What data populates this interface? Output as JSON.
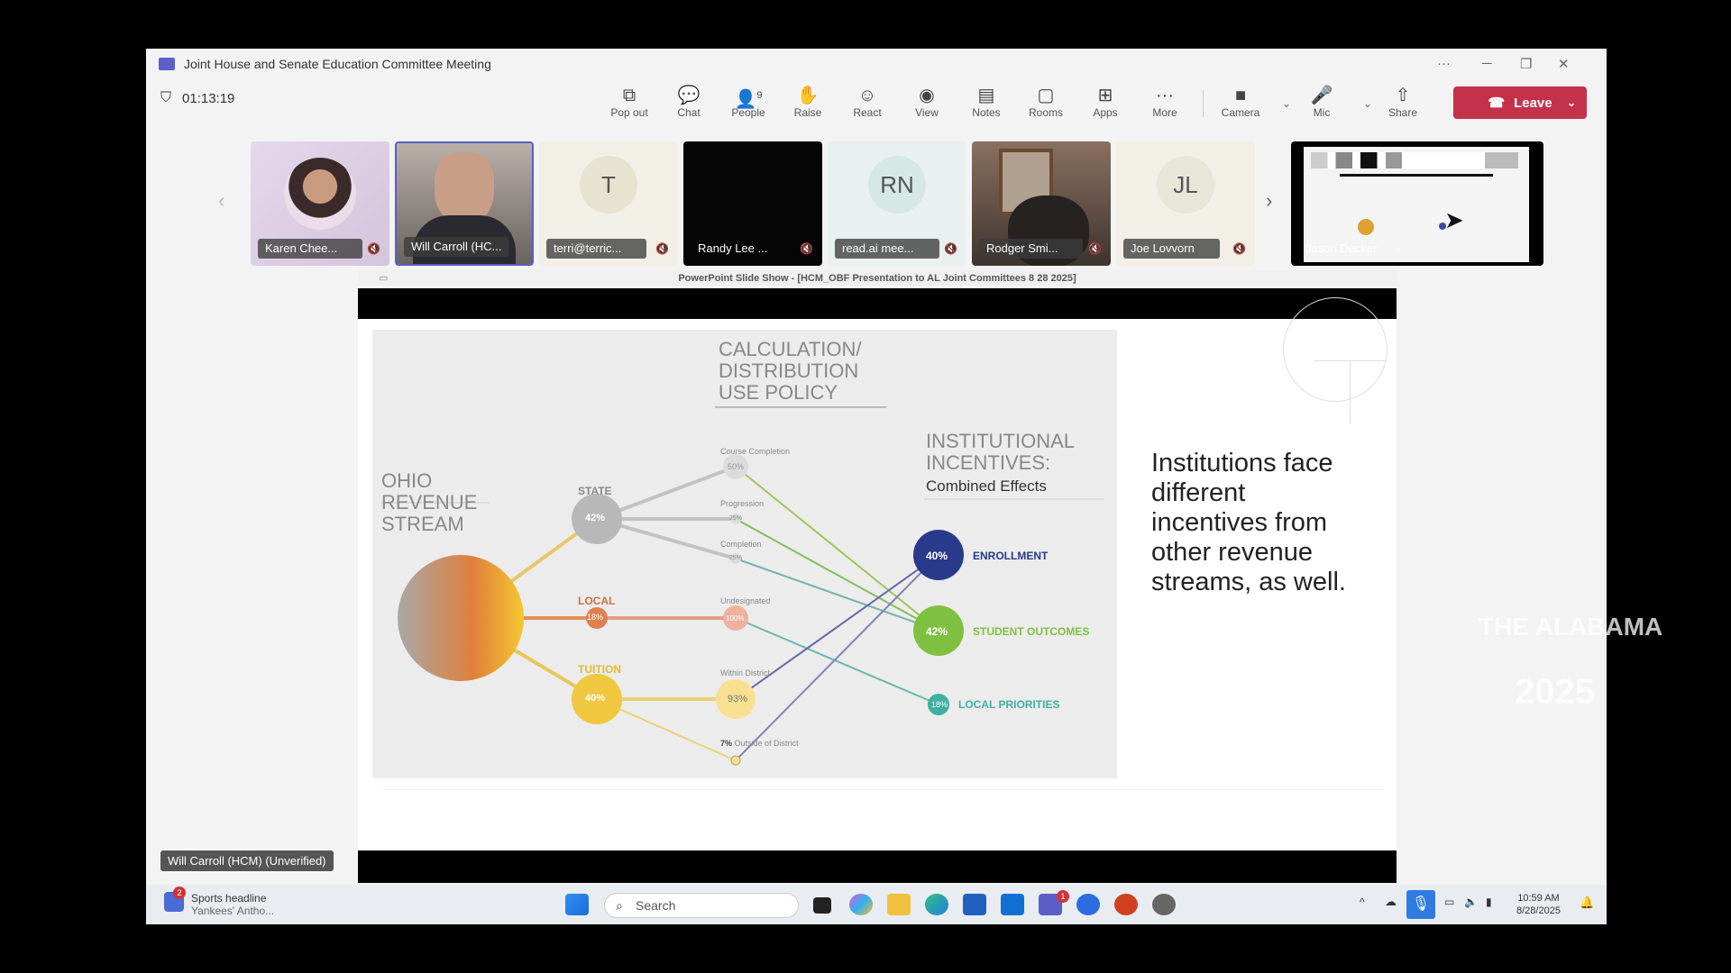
{
  "window": {
    "title": "Joint House and Senate Education Committee Meeting",
    "more": "···",
    "minimize": "─",
    "restore": "❐",
    "close": "✕"
  },
  "toolbar": {
    "timer": "01:13:19",
    "people_count": "9",
    "buttons": [
      {
        "label": "Pop out",
        "icon": "⧉"
      },
      {
        "label": "Chat",
        "icon": "💬"
      },
      {
        "label": "People",
        "icon": "👤"
      },
      {
        "label": "Raise",
        "icon": "✋"
      },
      {
        "label": "React",
        "icon": "☺"
      },
      {
        "label": "View",
        "icon": "◉"
      },
      {
        "label": "Notes",
        "icon": "▤"
      },
      {
        "label": "Rooms",
        "icon": "▢"
      },
      {
        "label": "Apps",
        "icon": "⊞"
      },
      {
        "label": "More",
        "icon": "···"
      },
      {
        "label": "Camera",
        "icon": "■"
      },
      {
        "label": "Mic",
        "icon": "🎤"
      },
      {
        "label": "Share",
        "icon": "⇧"
      }
    ],
    "leave_label": "Leave"
  },
  "participants": [
    {
      "name": "Karen Chee..."
    },
    {
      "name": "Will Carroll (HC..."
    },
    {
      "name": "terri@terric...",
      "initials": "T"
    },
    {
      "name": "Randy Lee ..."
    },
    {
      "name": "read.ai mee...",
      "initials": "RN"
    },
    {
      "name": "Rodger Smi..."
    },
    {
      "name": "Joe Lovvorn",
      "initials": "JL"
    },
    {
      "name": "Jason Decker"
    }
  ],
  "strip": {
    "prev": "‹",
    "next": "›",
    "more": "···"
  },
  "ppt_bar": "PowerPoint Slide Show - [HCM_OBF Presentation to AL Joint Committees 8 28 2025]",
  "slide": {
    "heading": [
      "CALCULATION/",
      "DISTRIBUTION",
      "USE POLICY"
    ],
    "source": [
      "OHIO",
      "REVENUE",
      "STREAM"
    ],
    "incentives": [
      "INSTITUTIONAL",
      "INCENTIVES:"
    ],
    "combined": "Combined Effects",
    "streams": [
      {
        "label": "STATE",
        "value": "42%"
      },
      {
        "label": "LOCAL",
        "value": "18%"
      },
      {
        "label": "TUITION",
        "value": "40%"
      }
    ],
    "policies": [
      {
        "label": "Course Completion",
        "value": "50%"
      },
      {
        "label": "Progression",
        "value": "25%"
      },
      {
        "label": "Completion",
        "value": "25%"
      },
      {
        "label": "Undesignated",
        "value": "100%"
      },
      {
        "label": "Within District",
        "value": "93%"
      },
      {
        "pct": "7%",
        "label": "Outside of District"
      }
    ],
    "outcomes": [
      {
        "value": "40%",
        "label": "ENROLLMENT"
      },
      {
        "value": "42%",
        "label": "STUDENT OUTCOMES"
      },
      {
        "value": "18%",
        "label": "LOCAL PRIORITIES"
      }
    ],
    "body_text": "Institutions face different incentives from other revenue streams, as well."
  },
  "speaker_badge": "Will Carroll (HCM) (Unverified)",
  "watermark": [
    "THE ALABAMA",
    "2025"
  ],
  "taskbar": {
    "news_title": "Sports headline",
    "news_sub": "Yankees' Antho...",
    "news_badge": "2",
    "search_placeholder": "Search",
    "teams_badge": "1",
    "time": "10:59 AM",
    "date": "8/28/2025"
  }
}
